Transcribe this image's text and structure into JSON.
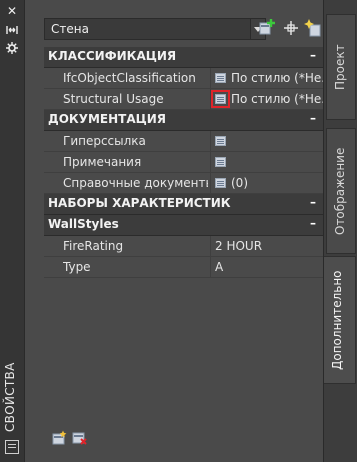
{
  "palette": {
    "title": "СВОЙСТВА"
  },
  "style_combo": {
    "value": "Стена"
  },
  "categories": [
    {
      "label": "КЛАССИФИКАЦИЯ",
      "collapse": "–",
      "rows": [
        {
          "name": "IfcObjectClassification",
          "value": "По стилю (*Не...",
          "icon": "table-icon"
        },
        {
          "name": "Structural Usage",
          "value": "По стилю (*Не...",
          "icon": "table-icon",
          "highlight": true
        }
      ]
    },
    {
      "label": "ДОКУМЕНТАЦИЯ",
      "collapse": "–",
      "rows": [
        {
          "name": "Гиперссылка",
          "value": "",
          "icon": "table-icon"
        },
        {
          "name": "Примечания",
          "value": "",
          "icon": "table-icon"
        },
        {
          "name": "Справочные документы",
          "value": "(0)",
          "icon": "table-icon"
        }
      ]
    },
    {
      "label": "НАБОРЫ ХАРАКТЕРИСТИК",
      "collapse": "–",
      "rows": []
    },
    {
      "label": "WallStyles",
      "collapse": "–",
      "rows": [
        {
          "name": "FireRating",
          "value": "2 HOUR"
        },
        {
          "name": "Type",
          "value": "A"
        }
      ]
    }
  ],
  "tabs": [
    {
      "label": "Проект",
      "active": false
    },
    {
      "label": "Отображение",
      "active": false
    },
    {
      "label": "Дополнительно",
      "active": true
    }
  ],
  "colors": {
    "highlight": "#e0242a",
    "background": "#4a4a4a",
    "header": "#3c3c3c"
  }
}
